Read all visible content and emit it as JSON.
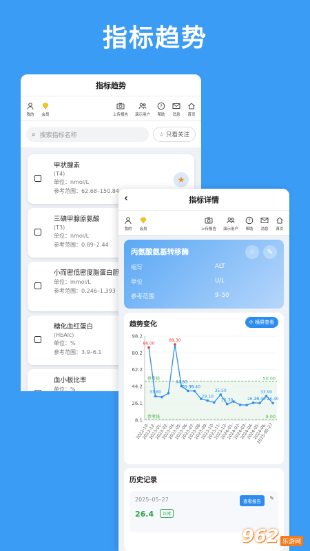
{
  "hero_title": "指标趋势",
  "back_screen": {
    "title": "指标趋势",
    "toolbar_left": [
      {
        "label": "我的",
        "icon": "person-icon"
      },
      {
        "label": "会员",
        "icon": "diamond-icon"
      }
    ],
    "toolbar_right": [
      {
        "label": "上传报告",
        "icon": "camera-icon"
      },
      {
        "label": "演示用户",
        "icon": "users-icon"
      },
      {
        "label": "帮助",
        "icon": "help-icon"
      },
      {
        "label": "消息",
        "icon": "mail-icon"
      },
      {
        "label": "首页",
        "icon": "home-icon"
      }
    ],
    "search_placeholder": "搜索指标名称",
    "favorites_label": "☆ 只看关注",
    "items": [
      {
        "name": "甲状腺素",
        "abbr": "(T4)",
        "unit": "单位：nmol/L",
        "range": "参考范围：62.68–150.84",
        "starred": true
      },
      {
        "name": "三碘甲腺原氨酸",
        "abbr": "(T3)",
        "unit": "单位：nmol/L",
        "range": "参考范围：0.89–2.44",
        "starred": false
      },
      {
        "name": "小而密低密度脂蛋白胆",
        "abbr": "",
        "unit": "单位：mmol/L",
        "range": "参考范围：0.246–1.393",
        "starred": false
      },
      {
        "name": "糖化血红蛋白",
        "abbr": "(HbAlc)",
        "unit": "单位：%",
        "range": "参考范围：3.9–6.1",
        "starred": false
      },
      {
        "name": "血小板比率",
        "abbr": "",
        "unit": "单位：%",
        "range": "参考范围：",
        "starred": false
      }
    ]
  },
  "front_screen": {
    "title": "指标详情",
    "toolbar_left": [
      {
        "label": "我的",
        "icon": "person-icon"
      },
      {
        "label": "会员",
        "icon": "diamond-icon"
      }
    ],
    "toolbar_right": [
      {
        "label": "上传报告",
        "icon": "camera-icon"
      },
      {
        "label": "演示用户",
        "icon": "users-icon"
      },
      {
        "label": "帮助",
        "icon": "help-icon"
      },
      {
        "label": "消息",
        "icon": "mail-icon"
      },
      {
        "label": "首页",
        "icon": "home-icon"
      }
    ],
    "detail": {
      "name": "丙氨酸氨基转移酶",
      "rows": [
        {
          "k": "缩写",
          "v": "ALT"
        },
        {
          "k": "单位",
          "v": "U/L"
        },
        {
          "k": "参考范围",
          "v": "9–50"
        }
      ]
    },
    "trend_title": "趋势变化",
    "landscape_label": "横屏查看",
    "history_title": "历史记录",
    "history": [
      {
        "date": "2025–05–27",
        "value": "26.4",
        "status": "正常",
        "button": "查看报告"
      }
    ]
  },
  "chart_data": {
    "type": "line",
    "x": [
      "2022-10-23",
      "2022-12-23",
      "2023-01-23",
      "2023-02-23",
      "2023-04-23",
      "2023-05-23",
      "2023-06-23",
      "2023-07-23",
      "2023-08-23",
      "2023-09-23",
      "2023-10-23",
      "2023-11-23",
      "2023-12-23",
      "2024-01-23",
      "2024-02-23",
      "2024-03-23",
      "2024-04-23",
      "2024-05-23",
      "2024-06-23",
      "2025-05-27"
    ],
    "x_tick_labels": [
      "2022-10-",
      "2022-12-",
      "2023-01-",
      "2023-02-",
      "2023-04-",
      "2023-05-",
      "2023-06-",
      "2023-07-",
      "2023-08-",
      "2023-09-",
      "2023-10-",
      "2023-11-",
      "2023-12-",
      "2024-01-",
      "2024-02-",
      "2024-03-",
      "2024-04-",
      "2024-05-",
      "2024-06-",
      "2025-05-27"
    ],
    "values": [
      86.0,
      33.8,
      32.8,
      37.0,
      89.3,
      44.6,
      39.5,
      39.4,
      31.0,
      29.1,
      27.1,
      35.5,
      25.3,
      28.0,
      24.5,
      24.3,
      26.7,
      26.4,
      33.9,
      26.4
    ],
    "point_labels": [
      "86.00",
      "33.80",
      "",
      "",
      "89.30",
      "44.60",
      "39.50",
      "39.40",
      "",
      "29.10",
      "",
      "35.50",
      "25.30",
      "",
      "",
      "",
      "26.70",
      "26.40",
      "33.90",
      "26.40"
    ],
    "y_ticks": [
      8.1,
      26.1,
      44.2,
      62.2,
      80.2,
      98.2
    ],
    "ylim": [
      8.1,
      98.2
    ],
    "ref_upper": 50.0,
    "ref_lower": 9.0,
    "ref_label_top": "参考线",
    "ref_label_bottom": "参考线",
    "ref_upper_label": "50.00",
    "ref_lower_label": "9.00",
    "line_color": "#2d8cf0",
    "abnormal_color": "#e53935",
    "ref_color": "#4caf50"
  },
  "watermark": {
    "number": "962",
    "sub": "乐游网"
  }
}
